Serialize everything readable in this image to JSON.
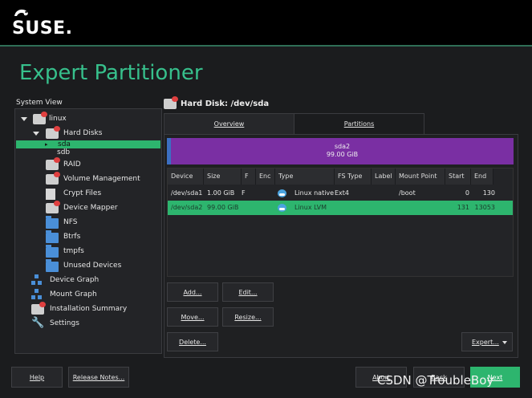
{
  "brand": {
    "logo_text": "SUSE."
  },
  "page": {
    "title": "Expert Partitioner"
  },
  "system_view": {
    "label": "System View",
    "tree": [
      {
        "label": "linux"
      },
      {
        "label": "Hard Disks"
      },
      {
        "label": "sda"
      },
      {
        "label": "sdb"
      },
      {
        "label": "RAID"
      },
      {
        "label": "Volume Management"
      },
      {
        "label": "Crypt Files"
      },
      {
        "label": "Device Mapper"
      },
      {
        "label": "NFS"
      },
      {
        "label": "Btrfs"
      },
      {
        "label": "tmpfs"
      },
      {
        "label": "Unused Devices"
      },
      {
        "label": "Device Graph"
      },
      {
        "label": "Mount Graph"
      },
      {
        "label": "Installation Summary"
      },
      {
        "label": "Settings"
      }
    ]
  },
  "disk_panel": {
    "heading": "Hard Disk: /dev/sda",
    "tabs": [
      {
        "label": "Overview"
      },
      {
        "label": "Partitions"
      }
    ],
    "bar": {
      "name": "sda2",
      "size": "99.00 GiB"
    },
    "columns": [
      "Device",
      "Size",
      "F",
      "Enc",
      "Type",
      "FS Type",
      "Label",
      "Mount Point",
      "Start",
      "End"
    ],
    "rows": [
      {
        "device": "/dev/sda1",
        "size": "1.00 GiB",
        "f": "F",
        "enc": "",
        "type": "Linux native",
        "fs_type": "Ext4",
        "label": "",
        "mount": "/boot",
        "start": "0",
        "end": "130"
      },
      {
        "device": "/dev/sda2",
        "size": "99.00 GiB",
        "f": "",
        "enc": "",
        "type": "Linux LVM",
        "fs_type": "",
        "label": "",
        "mount": "",
        "start": "131",
        "end": "13053"
      }
    ],
    "buttons": {
      "add": "Add...",
      "edit": "Edit...",
      "move": "Move...",
      "resize": "Resize...",
      "delete": "Delete...",
      "expert": "Expert..."
    }
  },
  "footer": {
    "help": "Help",
    "release_notes": "Release Notes...",
    "abort": "Abort",
    "back": "Back",
    "next": "Next"
  },
  "watermark": "CSDN @TroubleBoy",
  "colors": {
    "accent": "#2db56e",
    "title": "#37c08c",
    "partition_bar": "#7a2fa3"
  }
}
